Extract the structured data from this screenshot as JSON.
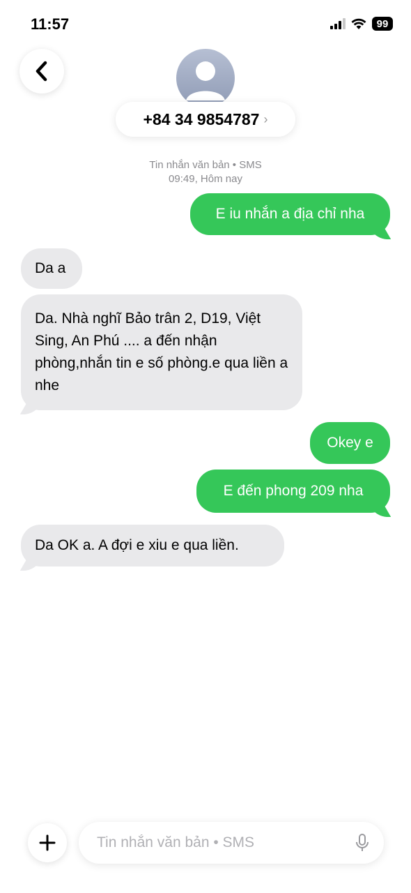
{
  "status_bar": {
    "time": "11:57",
    "battery": "99",
    "icons": [
      "signal-icon",
      "wifi-icon",
      "battery-icon"
    ]
  },
  "header": {
    "back_icon": "chevron-left-icon",
    "avatar_icon": "person-icon",
    "contact": "+84 34 9854787",
    "contact_chevron": "›"
  },
  "thread_meta": {
    "channel": "Tin nhắn văn bản • SMS",
    "timestamp": "09:49, Hôm nay"
  },
  "messages": [
    {
      "direction": "out",
      "text": "E iu nhắn a địa chỉ nha"
    },
    {
      "direction": "in",
      "text": "Da a"
    },
    {
      "direction": "in",
      "text": "Da. Nhà nghĩ Bảo trân 2, D19, Việt Sing, An Phú .... a đến nhận phòng,nhắn tin e số phòng.e qua liền a nhe"
    },
    {
      "direction": "out",
      "text": "Okey e"
    },
    {
      "direction": "out",
      "text": "E đến phong 209 nha"
    },
    {
      "direction": "in",
      "text": "Da OK a. A đợi e xiu e qua liền."
    }
  ],
  "compose": {
    "placeholder": "Tin nhắn văn bản • SMS",
    "value": "",
    "plus_icon": "plus-icon",
    "mic_icon": "microphone-icon"
  },
  "colors": {
    "outgoing": "#35c759",
    "incoming": "#e9e9eb",
    "meta_text": "#8a8a8e"
  }
}
